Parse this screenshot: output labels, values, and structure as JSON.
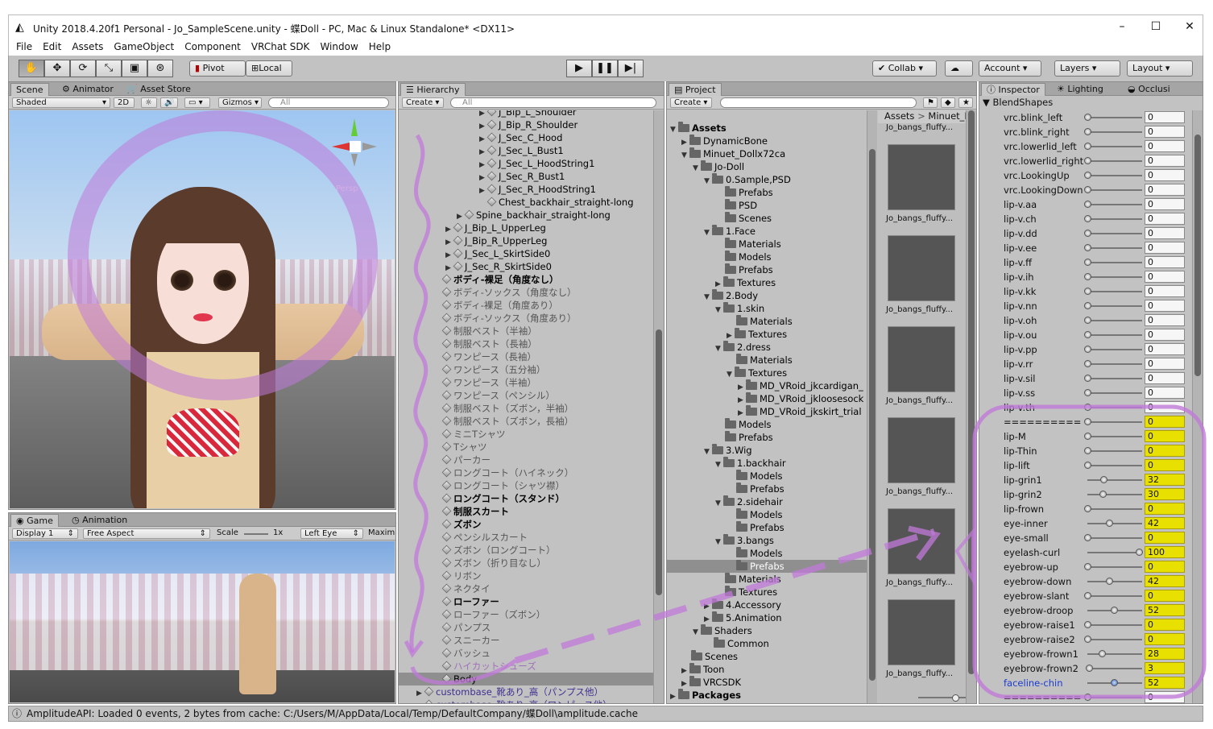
{
  "window": {
    "title": "Unity 2018.4.20f1 Personal - Jo_SampleScene.unity - 蝶Doll - PC, Mac & Linux Standalone* <DX11>"
  },
  "menu": [
    "File",
    "Edit",
    "Assets",
    "GameObject",
    "Component",
    "VRChat SDK",
    "Window",
    "Help"
  ],
  "toolbar": {
    "pivot": "Pivot",
    "local": "Local",
    "collab": "Collab ▾",
    "account": "Account",
    "layers": "Layers",
    "layout": "Layout"
  },
  "scene": {
    "tabs": [
      "Scene",
      "Animator",
      "Asset Store"
    ],
    "shading": "Shaded",
    "mode2d": "2D",
    "gizmos": "Gizmos",
    "search_placeholder": "All",
    "persp": "Persp"
  },
  "game": {
    "tabs": [
      "Game",
      "Animation"
    ],
    "display": "Display 1",
    "aspect": "Free Aspect",
    "scale_label": "Scale",
    "scale_value": "1x",
    "eye": "Left Eye",
    "maxim": "Maxim"
  },
  "hierarchy": {
    "tab": "Hierarchy",
    "create": "Create",
    "search_placeholder": "All",
    "rows": [
      "J_Bip_L_Shoulder",
      "J_Bip_R_Shoulder",
      "J_Sec_C_Hood",
      "J_Sec_L_Bust1",
      "J_Sec_L_HoodString1",
      "J_Sec_R_Bust1",
      "J_Sec_R_HoodString1",
      "Chest_backhair_straight-long",
      "Spine_backhair_straight-long",
      "J_Bip_L_UpperLeg",
      "J_Bip_R_UpperLeg",
      "J_Sec_L_SkirtSide0",
      "J_Sec_R_SkirtSide0",
      "ボディ-裸足（角度なし）",
      "ボディ-ソックス（角度なし）",
      "ボディ-裸足（角度あり）",
      "ボディ-ソックス（角度あり）",
      "制服ベスト（半袖）",
      "制服ベスト（長袖）",
      "ワンピース（長袖）",
      "ワンピース（五分袖）",
      "ワンピース（半袖）",
      "ワンピース（ペンシル）",
      "制服ベスト（ズボン，半袖）",
      "制服ベスト（ズボン，長袖）",
      "ミニTシャツ",
      "Tシャツ",
      "パーカー",
      "ロングコート（ハイネック）",
      "ロングコート（シャツ襟）",
      "ロングコート（スタンド）",
      "制服スカート",
      "ズボン",
      "ペンシルスカート",
      "ズボン（ロングコート）",
      "ズボン（折り目なし）",
      "リボン",
      "ネクタイ",
      "ローファー",
      "ローファー（ズボン）",
      "パンプス",
      "スニーカー",
      "バッシュ",
      "ハイカットシューズ",
      "Body",
      "custombase_靴あり_高（パンプス他）",
      "custombase_靴あり_高（ワンピース他）"
    ]
  },
  "project": {
    "tab": "Project",
    "create": "Create",
    "breadcrumb": [
      "Assets",
      "Minuet_Do"
    ],
    "thumb_label": "Jo_bangs_fluffy...",
    "tree": [
      "Assets",
      "DynamicBone",
      "Minuet_Dollx72ca",
      "Jo-Doll",
      "0.Sample,PSD",
      "Prefabs",
      "PSD",
      "Scenes",
      "1.Face",
      "Materials",
      "Models",
      "Prefabs",
      "Textures",
      "2.Body",
      "1.skin",
      "Materials",
      "Textures",
      "2.dress",
      "Materials",
      "Textures",
      "MD_VRoid_jkcardigan_",
      "MD_VRoid_jkloosesock",
      "MD_VRoid_jkskirt_trial",
      "Models",
      "Prefabs",
      "3.Wig",
      "1.backhair",
      "Models",
      "Prefabs",
      "2.sidehair",
      "Models",
      "Prefabs",
      "3.bangs",
      "Models",
      "Prefabs",
      "Materials",
      "Textures",
      "4.Accessory",
      "5.Animation",
      "Shaders",
      "Common",
      "Scenes",
      "Toon",
      "VRCSDK",
      "Packages"
    ]
  },
  "inspector": {
    "tabs": [
      "Inspector",
      "Lighting",
      "Occlusi"
    ],
    "section": "BlendShapes",
    "shapes": [
      {
        "name": "vrc.blink_left",
        "value": "0"
      },
      {
        "name": "vrc.blink_right",
        "value": "0"
      },
      {
        "name": "vrc.lowerlid_left",
        "value": "0"
      },
      {
        "name": "vrc.lowerlid_right",
        "value": "0"
      },
      {
        "name": "vrc.LookingUp",
        "value": "0"
      },
      {
        "name": "vrc.LookingDown",
        "value": "0"
      },
      {
        "name": "lip-v.aa",
        "value": "0"
      },
      {
        "name": "lip-v.ch",
        "value": "0"
      },
      {
        "name": "lip-v.dd",
        "value": "0"
      },
      {
        "name": "lip-v.ee",
        "value": "0"
      },
      {
        "name": "lip-v.ff",
        "value": "0"
      },
      {
        "name": "lip-v.ih",
        "value": "0"
      },
      {
        "name": "lip-v.kk",
        "value": "0"
      },
      {
        "name": "lip-v.nn",
        "value": "0"
      },
      {
        "name": "lip-v.oh",
        "value": "0"
      },
      {
        "name": "lip-v.ou",
        "value": "0"
      },
      {
        "name": "lip-v.pp",
        "value": "0"
      },
      {
        "name": "lip-v.rr",
        "value": "0"
      },
      {
        "name": "lip-v.sil",
        "value": "0"
      },
      {
        "name": "lip-v.ss",
        "value": "0"
      },
      {
        "name": "lip-v.th",
        "value": "0"
      },
      {
        "name": "==========",
        "value": "0"
      },
      {
        "name": "lip-M",
        "value": "0"
      },
      {
        "name": "lip-Thin",
        "value": "0"
      },
      {
        "name": "lip-lift",
        "value": "0"
      },
      {
        "name": "lip-grin1",
        "value": "32"
      },
      {
        "name": "lip-grin2",
        "value": "30"
      },
      {
        "name": "lip-frown",
        "value": "0"
      },
      {
        "name": "eye-inner",
        "value": "42"
      },
      {
        "name": "eye-small",
        "value": "0"
      },
      {
        "name": "eyelash-curl",
        "value": "100"
      },
      {
        "name": "eyebrow-up",
        "value": "0"
      },
      {
        "name": "eyebrow-down",
        "value": "42"
      },
      {
        "name": "eyebrow-slant",
        "value": "0"
      },
      {
        "name": "eyebrow-droop",
        "value": "52"
      },
      {
        "name": "eyebrow-raise1",
        "value": "0"
      },
      {
        "name": "eyebrow-raise2",
        "value": "0"
      },
      {
        "name": "eyebrow-frown1",
        "value": "28"
      },
      {
        "name": "eyebrow-frown2",
        "value": "3"
      },
      {
        "name": "faceline-chin",
        "value": "52"
      },
      {
        "name": "==========",
        "value": "0"
      }
    ]
  },
  "status": {
    "message": "AmplitudeAPI: Loaded 0 events, 2 bytes from cache: C:/Users/M/AppData/Local/Temp/DefaultCompany/蝶Doll\\amplitude.cache"
  },
  "colors": {
    "annotation": "#c07ad8",
    "highlight": "#e8e000",
    "selected_text": "#1a3ad0"
  }
}
